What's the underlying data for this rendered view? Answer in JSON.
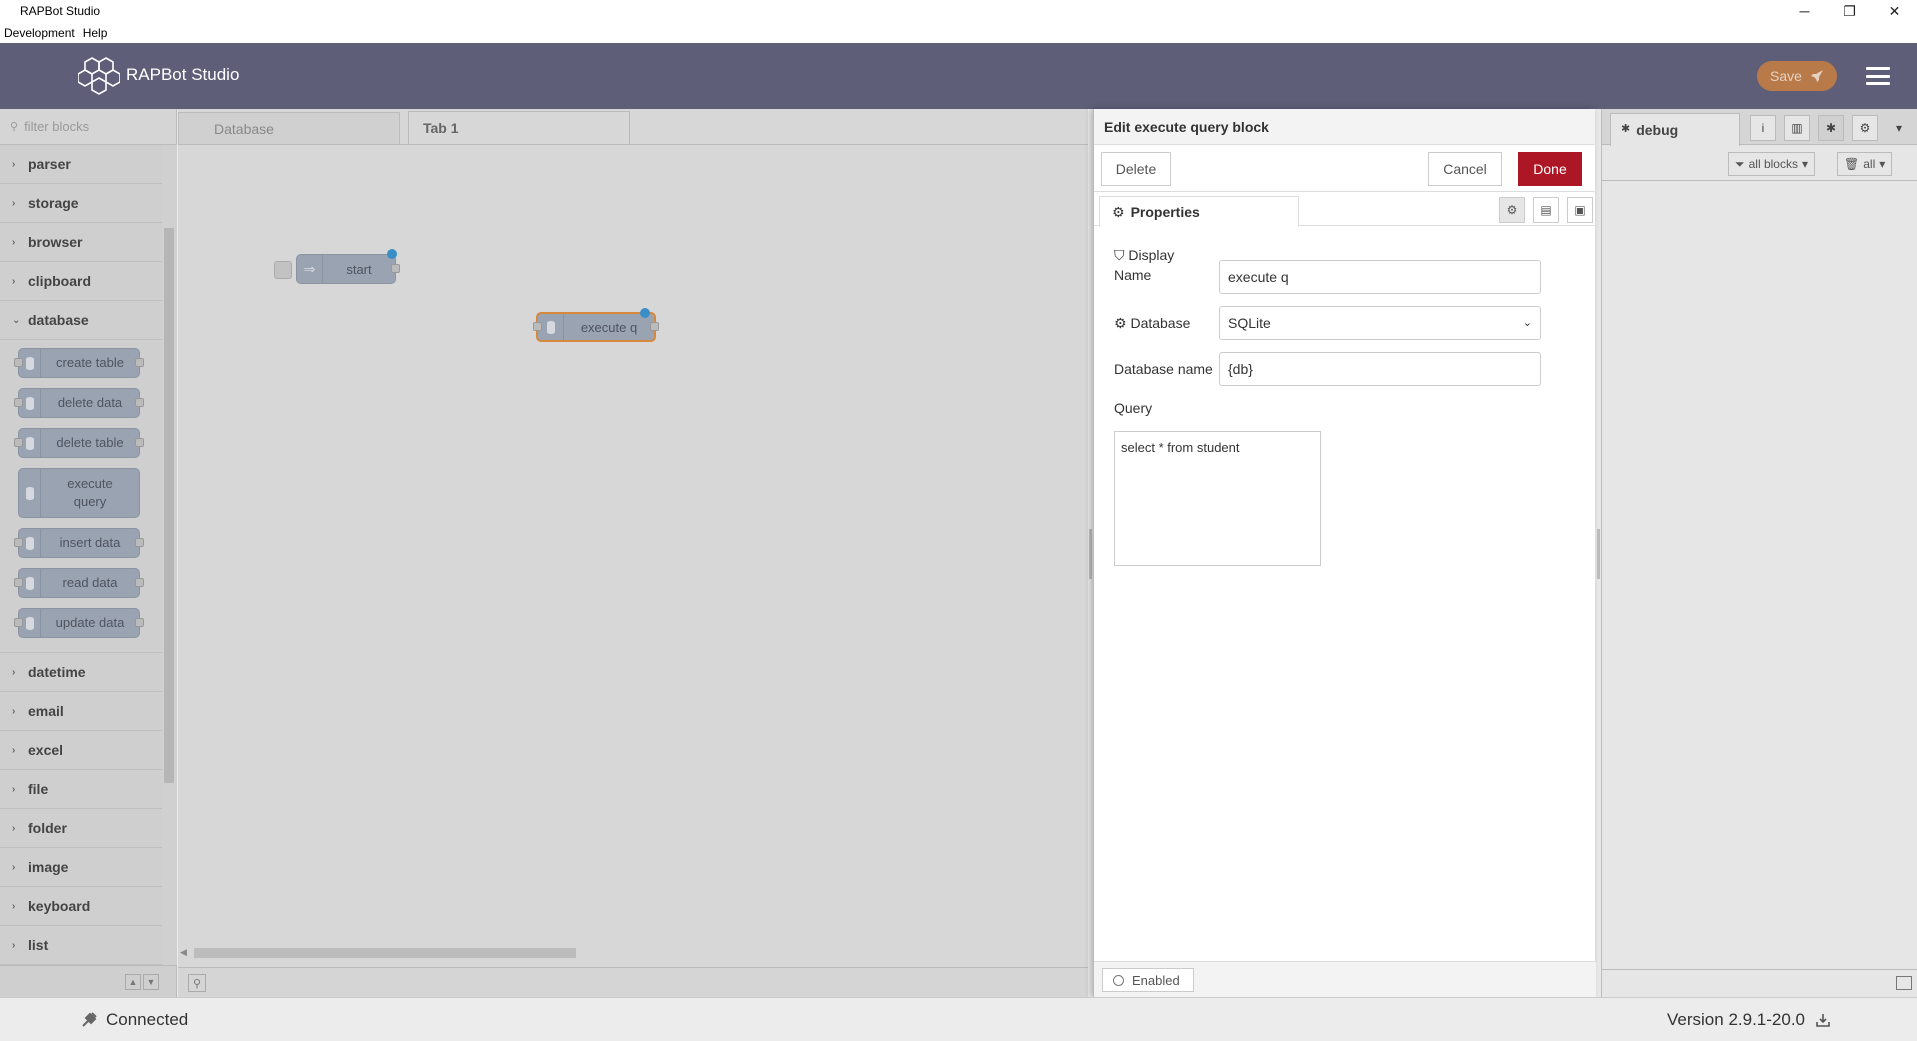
{
  "window": {
    "title": "RAPBot Studio",
    "controls": {
      "minimize": "─",
      "restore": "❐",
      "close": "✕"
    }
  },
  "menu": [
    "Development",
    "Help"
  ],
  "header": {
    "app_name": "RAPBot Studio",
    "save_label": "Save",
    "colors": {
      "background": "#5e5e78",
      "save": "#c97f41"
    }
  },
  "palette": {
    "filter_placeholder": "filter blocks",
    "categories_before": [
      "parser",
      "storage",
      "browser",
      "clipboard"
    ],
    "open_category": "database",
    "database_blocks": [
      "create table",
      "delete data",
      "delete table",
      "execute query",
      "insert data",
      "read data",
      "update data"
    ],
    "categories_after": [
      "datetime",
      "email",
      "excel",
      "file",
      "folder",
      "image",
      "keyboard",
      "list"
    ]
  },
  "workspace": {
    "tabs": [
      "Database",
      "Tab 1"
    ],
    "active_tab": "Tab 1",
    "nodes": {
      "start": "start",
      "execute": "execute q"
    }
  },
  "tray": {
    "title": "Edit execute query block",
    "delete_label": "Delete",
    "cancel_label": "Cancel",
    "done_label": "Done",
    "properties_tab": "Properties",
    "display_name_label": "Display",
    "display_name_label2": "Name",
    "display_name_value": "execute q",
    "database_label": "Database",
    "database_value": "SQLite",
    "database_name_label": "Database name",
    "database_name_value": "{db}",
    "query_label": "Query",
    "query_value": "select * from student",
    "enabled_label": "Enabled",
    "done_color": "#ad1625"
  },
  "sidebar": {
    "tab_label": "debug",
    "filter_label": "all blocks",
    "clear_label": "all"
  },
  "status": {
    "connection": "Connected",
    "version": "Version 2.9.1-20.0"
  }
}
